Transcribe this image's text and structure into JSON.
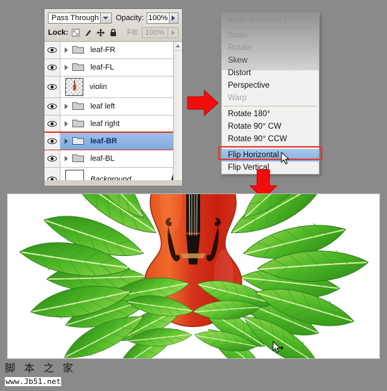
{
  "app": {
    "background_color": "#8a8a8a",
    "accent_red": "#e03a2f",
    "selection_blue": "#86aee0"
  },
  "layers_panel": {
    "blend_mode": "Pass Through",
    "opacity_label": "Opacity:",
    "opacity_value": "100%",
    "lock_label": "Lock:",
    "lock_icons": [
      "lock-transparent-pixels-icon",
      "lock-image-pixels-icon",
      "lock-position-icon",
      "lock-all-icon"
    ],
    "fill_label": "Fill:",
    "fill_value": "100%",
    "layers": [
      {
        "name": "leaf-FR",
        "type": "group",
        "visible": true,
        "selected": false,
        "locked": false
      },
      {
        "name": "leaf-FL",
        "type": "group",
        "visible": true,
        "selected": false,
        "locked": false
      },
      {
        "name": "violin",
        "type": "image",
        "visible": true,
        "selected": false,
        "locked": false
      },
      {
        "name": "leaf left",
        "type": "group",
        "visible": true,
        "selected": false,
        "locked": false
      },
      {
        "name": "leaf right",
        "type": "group",
        "visible": true,
        "selected": false,
        "locked": false
      },
      {
        "name": "leaf-BR",
        "type": "group",
        "visible": true,
        "selected": true,
        "locked": false
      },
      {
        "name": "leaf-BL",
        "type": "group",
        "visible": true,
        "selected": false,
        "locked": false
      },
      {
        "name": "Background",
        "type": "image",
        "visible": true,
        "selected": false,
        "locked": true
      }
    ]
  },
  "context_menu": {
    "title": "Again  Shift+Ctrl+T",
    "items": [
      {
        "label": "Scale",
        "state": "dim",
        "separator_after": false
      },
      {
        "label": "Rotate",
        "state": "dim",
        "separator_after": false
      },
      {
        "label": "Skew",
        "state": "normal",
        "separator_after": false
      },
      {
        "label": "Distort",
        "state": "normal",
        "separator_after": false
      },
      {
        "label": "Perspective",
        "state": "normal",
        "separator_after": false
      },
      {
        "label": "Warp",
        "state": "dim",
        "separator_after": true
      },
      {
        "label": "Rotate 180°",
        "state": "normal",
        "separator_after": false
      },
      {
        "label": "Rotate 90° CW",
        "state": "normal",
        "separator_after": false
      },
      {
        "label": "Rotate 90° CCW",
        "state": "normal",
        "separator_after": true
      },
      {
        "label": "Flip Horizontal",
        "state": "highlighted",
        "separator_after": false
      },
      {
        "label": "Flip Vertical",
        "state": "normal",
        "separator_after": false
      }
    ]
  },
  "annotations": {
    "arrow_right": "red-right-arrow",
    "arrow_down": "red-down-arrow",
    "layer_highlight_box": "red-rectangle-around-leaf-BR",
    "menu_highlight_box": "red-rectangle-around-flip-horizontal"
  },
  "artwork": {
    "description": "violin-with-green-leaves-composition",
    "violin_color": "#d9431f",
    "leaf_color": "#4fbb2b",
    "canvas_background": "#ffffff",
    "cursor": "move-tool-cursor"
  },
  "watermark": {
    "site_name": "脚 本 之 家",
    "url": "www.Jb51.net"
  }
}
